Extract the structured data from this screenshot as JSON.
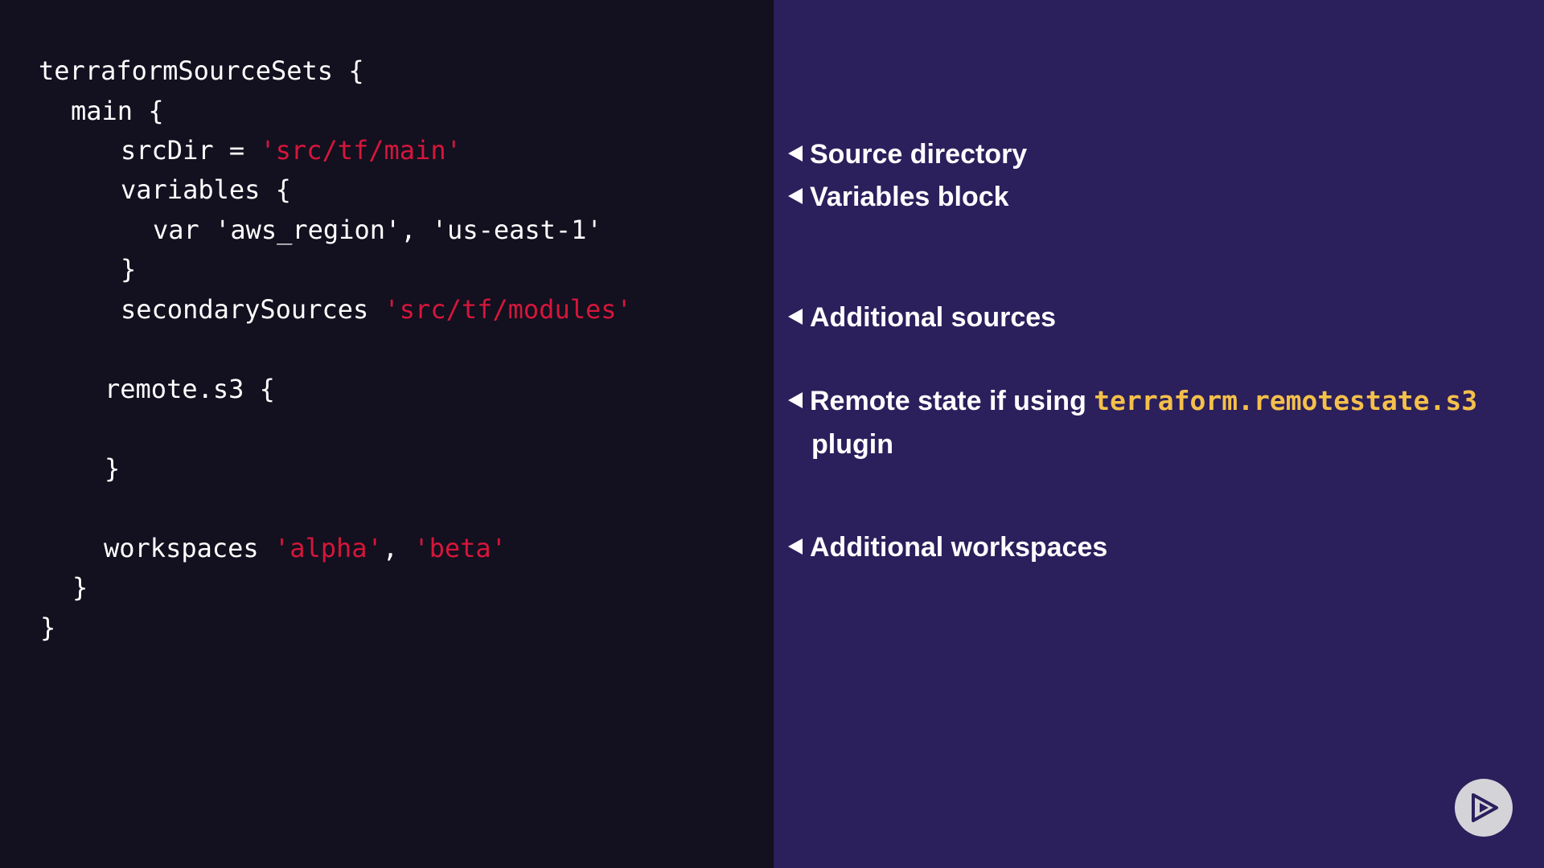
{
  "code": {
    "lines": [
      {
        "id": "l1",
        "segments": [
          {
            "t": "terraformSourceSets {",
            "k": "plain"
          }
        ]
      },
      {
        "id": "l2",
        "segments": [
          {
            "t": "main {",
            "k": "plain"
          }
        ]
      },
      {
        "id": "l3",
        "segments": [
          {
            "t": "srcDir = ",
            "k": "plain"
          },
          {
            "t": "'src/tf/main'",
            "k": "str"
          }
        ]
      },
      {
        "id": "l4",
        "segments": [
          {
            "t": "variables {",
            "k": "plain"
          }
        ]
      },
      {
        "id": "l5",
        "segments": [
          {
            "t": "var 'aws_region', 'us-east-1'",
            "k": "plain"
          }
        ]
      },
      {
        "id": "l6",
        "segments": [
          {
            "t": "}",
            "k": "plain"
          }
        ]
      },
      {
        "id": "l7",
        "segments": [
          {
            "t": "secondarySources ",
            "k": "plain"
          },
          {
            "t": "'src/tf/modules'",
            "k": "str"
          }
        ]
      },
      {
        "id": "l8",
        "segments": [
          {
            "t": "remote.s3 {",
            "k": "plain"
          }
        ]
      },
      {
        "id": "l9",
        "segments": [
          {
            "t": "}",
            "k": "plain"
          }
        ]
      },
      {
        "id": "l10",
        "segments": [
          {
            "t": "workspaces ",
            "k": "plain"
          },
          {
            "t": "'alpha'",
            "k": "str"
          },
          {
            "t": ", ",
            "k": "plain"
          },
          {
            "t": "'beta'",
            "k": "str"
          }
        ]
      },
      {
        "id": "l11",
        "segments": [
          {
            "t": "}",
            "k": "plain"
          }
        ]
      },
      {
        "id": "l12",
        "segments": [
          {
            "t": "}",
            "k": "plain"
          }
        ]
      }
    ]
  },
  "notes": {
    "source_directory": "Source directory",
    "variables_block": "Variables block",
    "additional_sources": "Additional sources",
    "remote_state_prefix": "Remote state if using ",
    "remote_state_code": "terraform.remotestate.s3",
    "remote_state_suffix": "plugin",
    "additional_workspaces": "Additional workspaces"
  },
  "colors": {
    "code_background": "#13101f",
    "notes_background": "#2b1f5c",
    "string_literal": "#d6163b",
    "code_reference": "#f5c04a"
  },
  "icons": {
    "pointer": "left-triangle-icon",
    "player": "play-icon"
  }
}
